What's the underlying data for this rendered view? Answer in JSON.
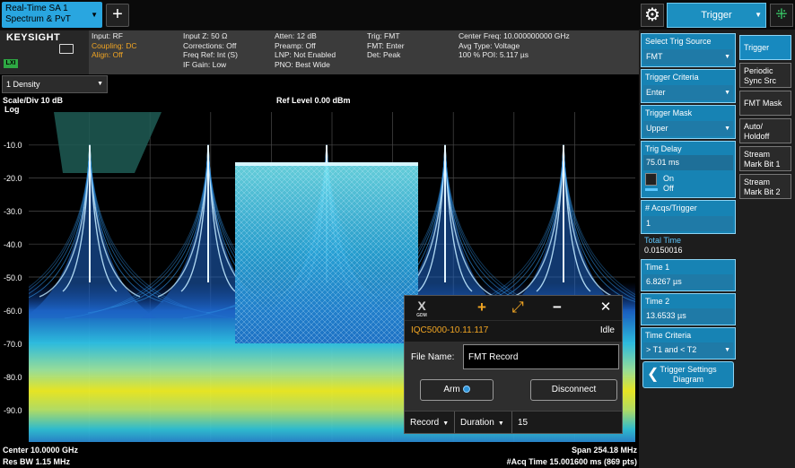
{
  "toolbar": {
    "mode_line1": "Real-Time SA 1",
    "mode_line2": "Spectrum & PvT",
    "add_symbol": "+",
    "settings_symbol": "⚙",
    "menu_title": "Trigger",
    "busy_symbol": "⁜"
  },
  "brand": {
    "logo_text": "KEYSIGHT",
    "lxi_text": "LXI"
  },
  "info": {
    "col1": [
      "Input: RF",
      "Coupling: DC",
      "Align: Off"
    ],
    "col2": [
      "Input Z: 50 Ω",
      "Corrections: Off",
      "Freq Ref: Int (S)",
      "IF Gain: Low"
    ],
    "col3": [
      "Atten: 12 dB",
      "Preamp: Off",
      "LNP: Not Enabled",
      "PNO: Best Wide"
    ],
    "col4": [
      "Trig: FMT",
      "FMT: Enter",
      "Det: Peak"
    ],
    "col5": [
      "Center Freq: 10.000000000 GHz",
      "Avg Type: Voltage",
      "100 % POI: 5.117 µs"
    ]
  },
  "trace": {
    "selector": "1 Density"
  },
  "plot": {
    "scale": "Scale/Div 10 dB",
    "log": "Log",
    "ref_level": "Ref Level 0.00 dBm",
    "y_ticks": [
      "-10.0",
      "-20.0",
      "-30.0",
      "-40.0",
      "-50.0",
      "-60.0",
      "-70.0",
      "-80.0",
      "-90.0"
    ]
  },
  "chart_data": {
    "type": "heatmap",
    "ylabel": "",
    "y_scale_per_div_db": 10,
    "ref_level_dbm": 0,
    "ylim": [
      -100,
      0
    ],
    "center_freq_ghz": 10.0,
    "span_mhz": 254.18,
    "tone_peaks_dbm": [
      -10,
      -10,
      -10,
      -10,
      -10
    ],
    "flat_block_top_dbm": -15,
    "noise_floor_band_dbm": [
      -85,
      -65
    ]
  },
  "bottom": {
    "center": "Center 10.0000 GHz",
    "res_bw": "Res BW 1.15 MHz",
    "span": "Span 254.18 MHz",
    "acq": "#Acq Time 15.001600 ms (869 pts)"
  },
  "iqc": {
    "logo": "X",
    "logo_sub": "GDM",
    "plus": "+",
    "expand": "⤢",
    "minimize": "−",
    "close": "✕",
    "device": "IQC5000-10.11.117",
    "state": "Idle",
    "file_label": "File Name:",
    "file_value": "FMT Record",
    "arm_label": "Arm",
    "disconnect_label": "Disconnect",
    "record_label": "Record",
    "duration_label": "Duration",
    "duration_value": "15"
  },
  "panel": {
    "trig_source_label": "Select Trig Source",
    "trig_source_value": "FMT",
    "criteria_label": "Trigger Criteria",
    "criteria_value": "Enter",
    "mask_label": "Trigger Mask",
    "mask_value": "Upper",
    "delay_label": "Trig Delay",
    "delay_value": "75.01 ms",
    "delay_on": "On",
    "delay_off": "Off",
    "acqs_label": "# Acqs/Trigger",
    "acqs_value": "1",
    "total_time_label": "Total Time",
    "total_time_value": "0.0150016",
    "time1_label": "Time 1",
    "time1_value": "6.8267 µs",
    "time2_label": "Time 2",
    "time2_value": "13.6533 µs",
    "time_criteria_label": "Time Criteria",
    "time_criteria_value": "> T1 and < T2",
    "diagram_line1": "Trigger Settings",
    "diagram_line2": "Diagram",
    "chevron": "❮"
  },
  "tabs": [
    "Trigger",
    "Periodic Sync Src",
    "FMT Mask",
    "Auto/ Holdoff",
    "Stream Mark Bit 1",
    "Stream Mark Bit 2"
  ]
}
